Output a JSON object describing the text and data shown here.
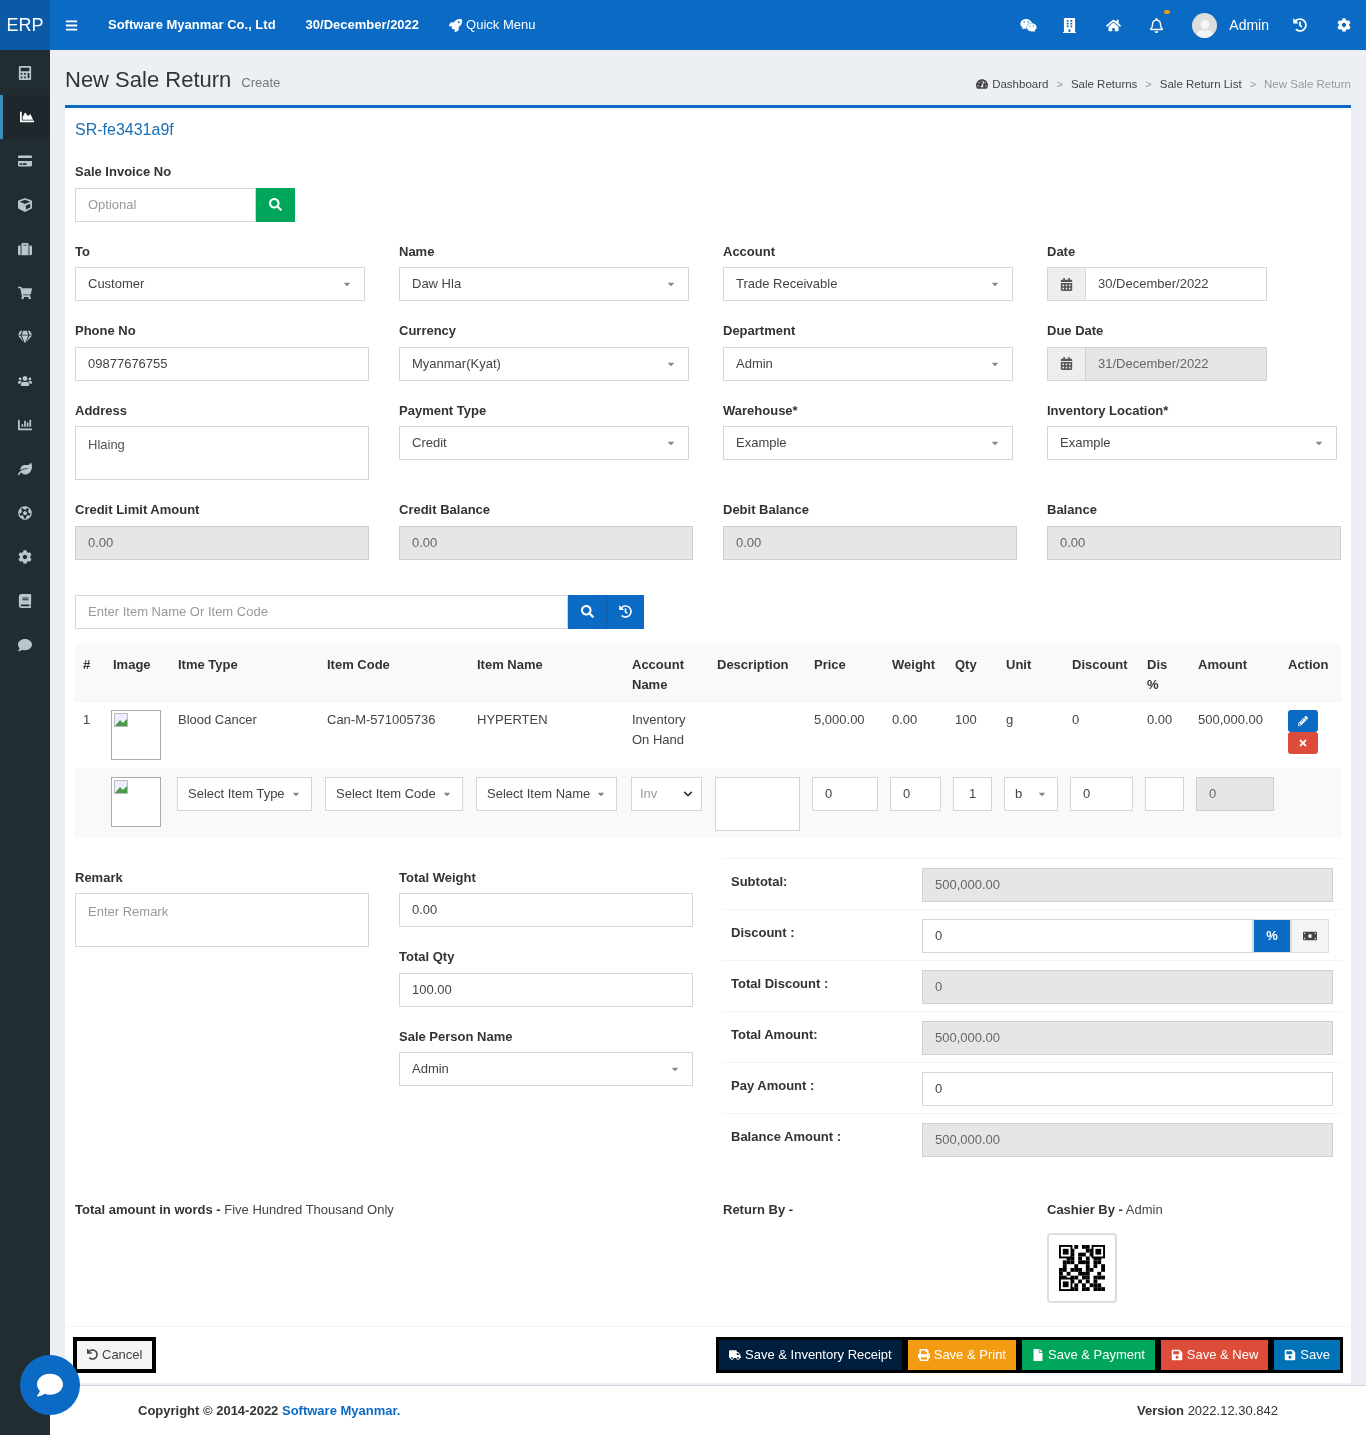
{
  "topbar": {
    "logo": "ERP",
    "company": "Software Myanmar Co., Ltd",
    "date": "30/December/2022",
    "quick_menu": "Quick Menu",
    "user": "Admin",
    "notifications": {
      "unread": true
    }
  },
  "sidebar": {
    "items": [
      {
        "selected": false
      },
      {
        "selected": true
      },
      {
        "selected": false
      },
      {
        "selected": false
      },
      {
        "selected": false
      },
      {
        "selected": false
      },
      {
        "selected": false
      },
      {
        "selected": false
      },
      {
        "selected": false
      },
      {
        "selected": false
      },
      {
        "selected": false
      },
      {
        "selected": false
      },
      {
        "selected": false
      },
      {
        "selected": false
      }
    ]
  },
  "page": {
    "title": "New Sale Return",
    "subtitle": "Create",
    "breadcrumbs": [
      {
        "label": "Dashboard",
        "current": false
      },
      {
        "separator": ">",
        "label": "Sale Returns",
        "current": false
      },
      {
        "separator": ">",
        "label": "Sale Return List",
        "current": false
      },
      {
        "separator": ">",
        "label": "New Sale Return",
        "current": true
      }
    ]
  },
  "form": {
    "code": "SR-fe3431a9f",
    "invoice": {
      "label": "Sale Invoice No",
      "placeholder": "Optional"
    },
    "fields": [
      {
        "label": "To",
        "kind": "select",
        "value": "Customer"
      },
      {
        "label": "Name",
        "kind": "select",
        "value": "Daw Hla"
      },
      {
        "label": "Account",
        "kind": "select",
        "value": "Trade Receivable"
      },
      {
        "label": "Date",
        "kind": "date",
        "value": "30/December/2022",
        "readonly": false
      },
      {
        "label": "Phone No",
        "kind": "text",
        "value": "09877676755",
        "readonly": false
      },
      {
        "label": "Currency",
        "kind": "select",
        "value": "Myanmar(Kyat)"
      },
      {
        "label": "Department",
        "kind": "select",
        "value": "Admin"
      },
      {
        "label": "Due Date",
        "kind": "date",
        "value": "31/December/2022",
        "readonly": true
      },
      {
        "label": "Address",
        "kind": "textarea",
        "value": "Hlaing",
        "readonly": false
      },
      {
        "label": "Payment Type",
        "kind": "select",
        "value": "Credit"
      },
      {
        "label": "Warehouse*",
        "kind": "select",
        "value": "Example"
      },
      {
        "label": "Inventory Location*",
        "kind": "select",
        "value": "Example"
      },
      {
        "label": "Credit Limit Amount",
        "kind": "text",
        "value": "0.00",
        "readonly": true
      },
      {
        "label": "Credit Balance",
        "kind": "text",
        "value": "0.00",
        "readonly": true
      },
      {
        "label": "Debit Balance",
        "kind": "text",
        "value": "0.00",
        "readonly": true
      },
      {
        "label": "Balance",
        "kind": "text",
        "value": "0.00",
        "readonly": true
      }
    ],
    "item_search": {
      "placeholder": "Enter Item Name Or Item Code"
    }
  },
  "table": {
    "columns": [
      "#",
      "Image",
      "Itme Type",
      "Item Code",
      "Item Name",
      "Account Name",
      "Description",
      "Price",
      "Weight",
      "Qty",
      "Unit",
      "Discount",
      "Dis %",
      "Amount",
      "Action"
    ],
    "rows": [
      {
        "no": "1",
        "item_type": "Blood Cancer",
        "item_code": "Can-M-571005736",
        "item_name": "HYPERTEN",
        "account_name": "Inventory On Hand",
        "price": "5,000.00",
        "weight": "0.00",
        "qty": "100",
        "unit": "g",
        "discount": "0",
        "dis_percent": "0.00",
        "amount": "500,000.00"
      }
    ],
    "entry_row": {
      "item_type": "Select Item Type",
      "item_code": "Select Item Code",
      "item_name": "Select Item Name",
      "account": "Inv",
      "price": "0",
      "weight": "0",
      "qty": "1",
      "unit": "b",
      "discount": "0",
      "amount": "0"
    }
  },
  "remark": {
    "label": "Remark",
    "placeholder": "Enter Remark"
  },
  "totals": [
    {
      "label": "Total Weight",
      "kind": "text",
      "value": "0.00"
    },
    {
      "label": "Total Qty",
      "kind": "text",
      "value": "100.00"
    },
    {
      "label": "Sale Person Name",
      "kind": "select",
      "value": "Admin"
    }
  ],
  "summary": [
    {
      "label": "Subtotal:",
      "kind": "field",
      "value": "500,000.00",
      "readonly": true
    },
    {
      "label": "Discount :",
      "kind": "discount",
      "value": "0",
      "readonly": false,
      "modes": [
        {
          "kind": "percent",
          "label": "%",
          "selected": true
        },
        {
          "kind": "cash",
          "selected": false
        }
      ]
    },
    {
      "label": "Total Discount :",
      "kind": "field",
      "value": "0",
      "readonly": true
    },
    {
      "label": "Total Amount:",
      "kind": "field",
      "value": "500,000.00",
      "readonly": true
    },
    {
      "label": "Pay Amount :",
      "kind": "field",
      "value": "0",
      "readonly": false
    },
    {
      "label": "Balance Amount :",
      "kind": "field",
      "value": "500,000.00",
      "readonly": true
    }
  ],
  "signatures": [
    {
      "label": "Total amount in words -",
      "value": "Five Hundred Thousand Only"
    },
    {
      "label": "Return By -"
    },
    {
      "label": "Cashier By -",
      "value": "Admin",
      "qr": true
    }
  ],
  "actions": {
    "cancel": "Cancel",
    "buttons": [
      {
        "kind": "inventory",
        "label": "Save & Inventory Receipt"
      },
      {
        "kind": "print",
        "label": "Save & Print"
      },
      {
        "kind": "payment",
        "label": "Save & Payment"
      },
      {
        "kind": "new",
        "label": "Save & New"
      },
      {
        "kind": "save",
        "label": "Save"
      }
    ]
  },
  "footer": {
    "copyright": "Copyright © 2014-2022",
    "company": "Software Myanmar.",
    "version_label": "Version",
    "version": "2022.12.30.842"
  }
}
